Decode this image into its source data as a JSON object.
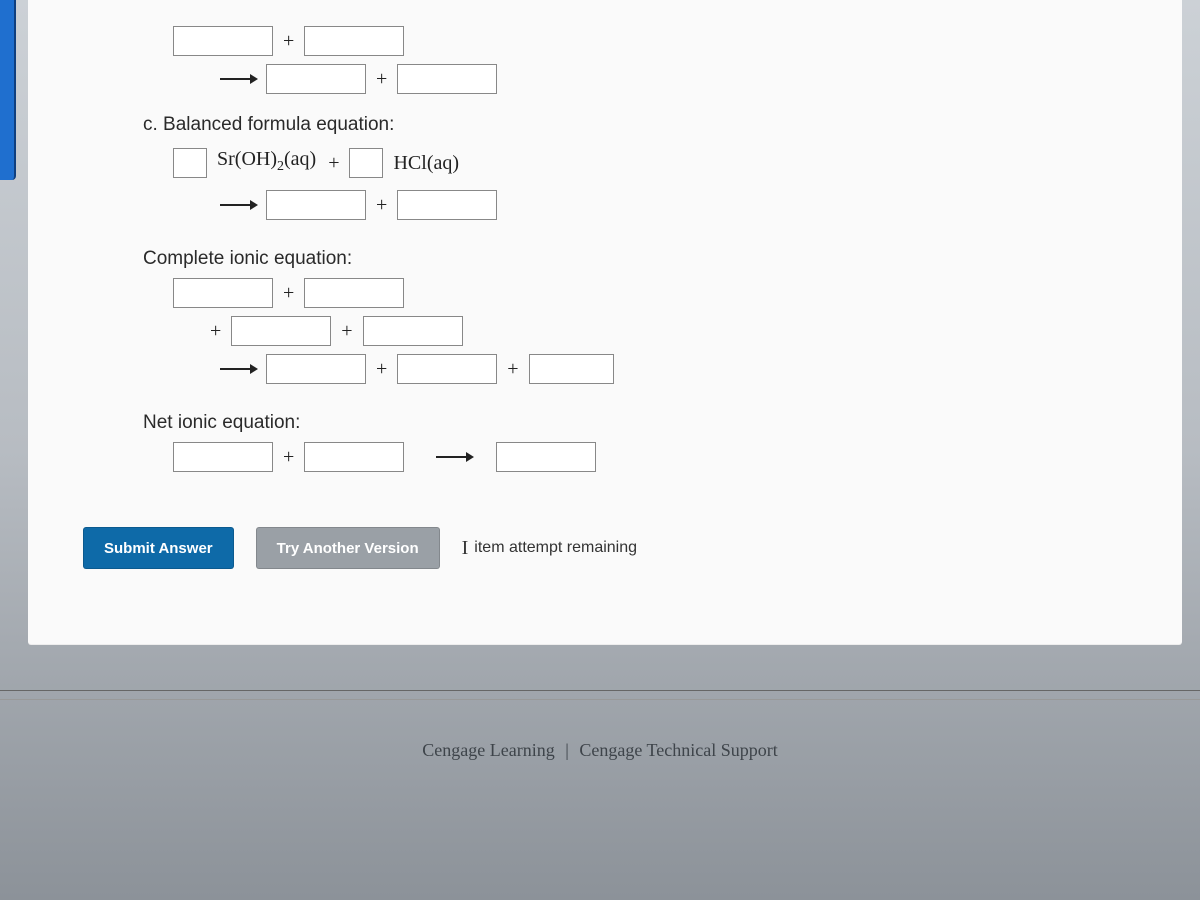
{
  "sections": {
    "c_label": "c. Balanced formula equation:",
    "balanced": {
      "reagent1": "Sr(OH)₂(aq)",
      "reagent2": "HCl(aq)",
      "plus": "+"
    },
    "complete_label": "Complete ionic equation:",
    "net_label": "Net ionic equation:",
    "plus": "+"
  },
  "buttons": {
    "submit": "Submit Answer",
    "try": "Try Another Version"
  },
  "attempts": {
    "count_label": "item attempt remaining"
  },
  "footer": {
    "brand": "Cengage Learning",
    "sep": "|",
    "support": "Cengage Technical Support"
  }
}
